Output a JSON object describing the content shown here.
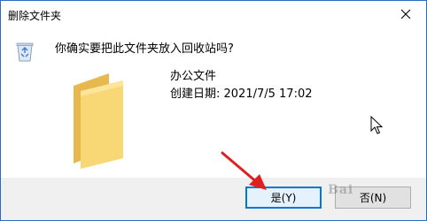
{
  "window": {
    "title": "删除文件夹",
    "close_glyph": "✕"
  },
  "message": {
    "question": "你确实要把此文件夹放入回收站吗?"
  },
  "item": {
    "name": "办公文件",
    "created": "创建日期: 2021/7/5 17:02"
  },
  "buttons": {
    "yes_label": "是(Y)",
    "no_label": "否(N)"
  },
  "watermark": {
    "text": "Bai"
  },
  "colors": {
    "accent": "#0078d7",
    "folder": "#f5d27a",
    "arrow": "#e02020"
  },
  "icons": {
    "dialog_icon": "recycle-bin-icon",
    "item_icon": "folder-icon",
    "pointer": "mouse-cursor-icon",
    "annotation": "red-arrow-icon"
  }
}
